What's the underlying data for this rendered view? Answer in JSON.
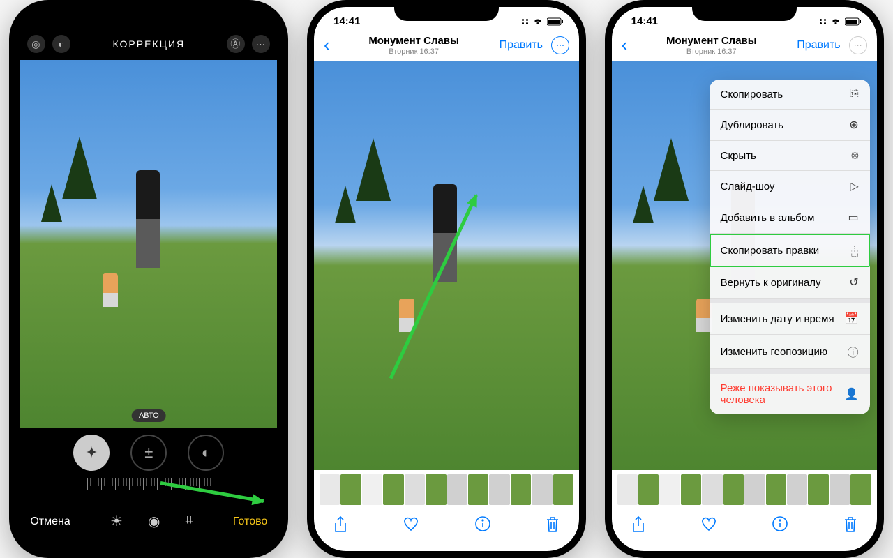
{
  "phone1": {
    "title": "КОРРЕКЦИЯ",
    "auto_badge": "АВТО",
    "cancel": "Отмена",
    "done": "Готово"
  },
  "phone2": {
    "time": "14:41",
    "title": "Монумент Славы",
    "subtitle": "Вторник 16:37",
    "edit": "Править"
  },
  "phone3": {
    "time": "14:41",
    "title": "Монумент Славы",
    "subtitle": "Вторник 16:37",
    "edit": "Править",
    "menu": {
      "copy": "Скопировать",
      "duplicate": "Дублировать",
      "hide": "Скрыть",
      "slideshow": "Слайд-шоу",
      "add_album": "Добавить в альбом",
      "copy_edits": "Скопировать правки",
      "revert": "Вернуть к оригиналу",
      "change_date": "Изменить дату и время",
      "change_geo": "Изменить геопозицию",
      "hide_person": "Реже показывать этого человека"
    }
  }
}
